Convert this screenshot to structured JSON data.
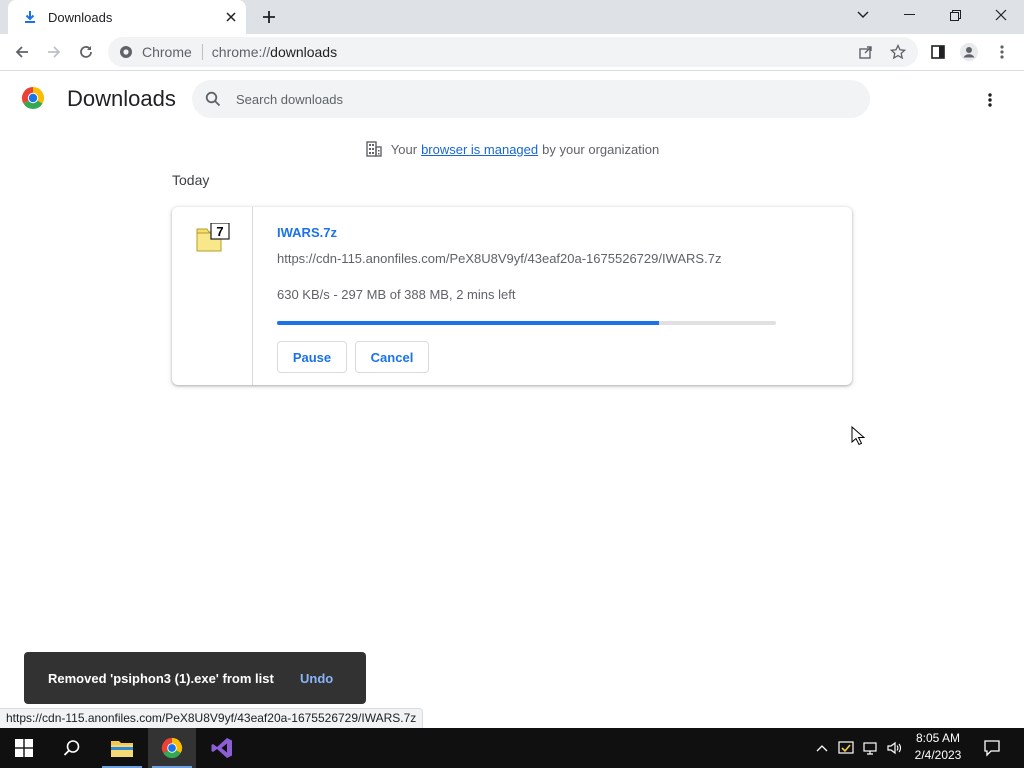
{
  "browser": {
    "tab": {
      "title": "Downloads"
    },
    "omnibox": {
      "chip": "Chrome",
      "url_scheme": "chrome://",
      "url_path": "downloads"
    }
  },
  "page": {
    "title": "Downloads",
    "search": {
      "placeholder": "Search downloads"
    },
    "managed": {
      "prefix": "Your",
      "link": "browser is managed",
      "suffix": "by your organization"
    },
    "section": "Today"
  },
  "download": {
    "filename": "IWARS.7z",
    "url": "https://cdn-115.anonfiles.com/PeX8U8V9yf/43eaf20a-1675526729/IWARS.7z",
    "status": "630 KB/s - 297 MB of 388 MB, 2 mins left",
    "progress_fraction": 0.765,
    "pause_label": "Pause",
    "cancel_label": "Cancel",
    "file_icon_label": "7"
  },
  "toast": {
    "message": "Removed 'psiphon3 (1).exe' from list",
    "undo": "Undo"
  },
  "status_bubble": "https://cdn-115.anonfiles.com/PeX8U8V9yf/43eaf20a-1675526729/IWARS.7z",
  "taskbar": {
    "time": "8:05 AM",
    "date": "2/4/2023"
  },
  "colors": {
    "accent": "#1a73e8",
    "progress_track": "#e0e0e0",
    "toast_bg": "#323232",
    "toast_link": "#8ab4f8"
  }
}
